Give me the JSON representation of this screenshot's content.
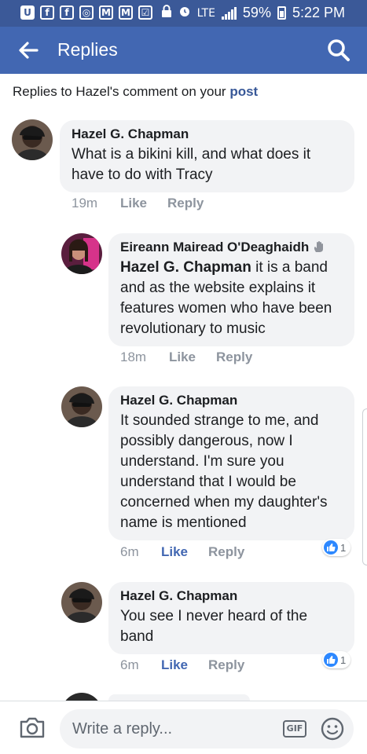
{
  "status_bar": {
    "left_icons": [
      {
        "name": "u-app-icon",
        "glyph": "U"
      },
      {
        "name": "facebook-notification-icon",
        "glyph": "f"
      },
      {
        "name": "facebook-notification-icon-2",
        "glyph": "f"
      },
      {
        "name": "instagram-icon",
        "glyph": "◎"
      },
      {
        "name": "gmail-icon",
        "glyph": "M"
      },
      {
        "name": "gmail-icon-2",
        "glyph": "M"
      },
      {
        "name": "checklist-icon",
        "glyph": "☑"
      }
    ],
    "network_label": "LTE",
    "battery": "59%",
    "time": "5:22 PM"
  },
  "header": {
    "title": "Replies",
    "back_icon": "arrow-left-icon",
    "search_icon": "search-icon"
  },
  "context": {
    "prefix": "Replies to Hazel's comment on your ",
    "link": "post"
  },
  "comments": [
    {
      "author": "Hazel G. Chapman",
      "mention": "",
      "text": "What is a bikini kill, and what does it have to do with Tracy",
      "time": "19m",
      "like": "Like",
      "reply": "Reply",
      "liked": false,
      "reaction_count": ""
    },
    {
      "author": "Eireann Mairead O'Deaghaidh",
      "author_badge": "wave-icon",
      "mention": "Hazel G. Chapman",
      "text": " it is a band and as the website explains it features women who have been revolutionary to music",
      "time": "18m",
      "like": "Like",
      "reply": "Reply",
      "liked": false,
      "reaction_count": ""
    },
    {
      "author": "Hazel G. Chapman",
      "mention": "",
      "text": "It sounded strange to me, and possibly dangerous, now I understand.  I'm sure you understand that I would be concerned when my daughter's name is mentioned",
      "time": "6m",
      "like": "Like",
      "reply": "Reply",
      "liked": true,
      "reaction_count": "1"
    },
    {
      "author": "Hazel G. Chapman",
      "mention": "",
      "text": "You see I never heard of the band",
      "time": "6m",
      "like": "Like",
      "reply": "Reply",
      "liked": true,
      "reaction_count": "1"
    }
  ],
  "composer": {
    "placeholder": "Write a reply...",
    "gif_label": "GIF",
    "camera_icon": "camera-icon",
    "emoji_icon": "emoji-icon"
  },
  "colors": {
    "status_bar": "#3b5998",
    "header": "#4267b2",
    "link": "#385898",
    "bubble": "#f2f3f5",
    "like_active": "#4267b2",
    "meta": "#8d949e",
    "reaction": "#2d88ff"
  }
}
